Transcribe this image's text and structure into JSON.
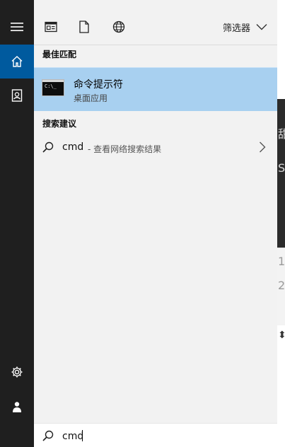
{
  "tabs": [
    {
      "icon": "apps-icon",
      "label": ""
    },
    {
      "icon": "document-icon",
      "label": ""
    },
    {
      "icon": "web-icon",
      "label": ""
    }
  ],
  "filter": {
    "label": "筛选器",
    "icon": "chevron-down-icon"
  },
  "rail": {
    "items": [
      {
        "icon": "hamburger-menu-icon"
      },
      {
        "icon": "home-icon",
        "active": true
      },
      {
        "icon": "contact-card-icon"
      },
      {
        "icon": "gear-icon"
      },
      {
        "icon": "user-icon"
      }
    ]
  },
  "best_match": {
    "header": "最佳匹配",
    "title": "命令提示符",
    "subtitle": "桌面应用",
    "icon_text": "C:\\_"
  },
  "suggestions": {
    "header": "搜索建议",
    "items": [
      {
        "query": "cmd",
        "hint": "- 查看网络搜索结果"
      }
    ]
  },
  "search": {
    "value": "cmd",
    "placeholder": ""
  },
  "colors": {
    "rail_bg": "#1f1f1f",
    "rail_active": "#005a9e",
    "panel_bg": "#f2f2f2",
    "selected_bg": "#a8d0f0"
  }
}
